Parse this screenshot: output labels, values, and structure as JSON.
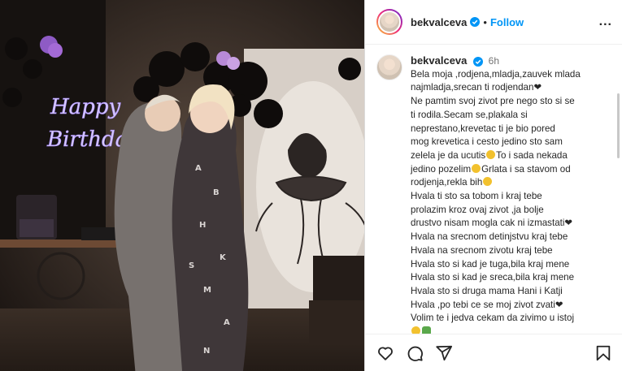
{
  "post": {
    "username": "bekvalceva",
    "follow_label": "Follow",
    "dot": "•",
    "more_label": "...",
    "photo": {
      "neon_line1": "Happy",
      "neon_line2": "Birthday",
      "neon_color": "#c9b8ff"
    }
  },
  "caption": {
    "username": "bekvalceva",
    "time": "6h",
    "lines": [
      "Bela moja ,rodjena,mladja,zauvek mlada",
      "najmladja,srecan ti rodjendan❤",
      "Ne pamtim svoj zivot pre nego sto si se",
      "ti rodila.Secam se,plakala si",
      "neprestano,krevetac ti je bio pored",
      "mog krevetica i cesto jedino sto sam",
      "zelela je da ucutis",
      "To i sada nekada",
      "jedino pozelim",
      "Grlata i sa stavom od",
      "rodjenja,rekla bih",
      "Hvala ti sto sa tobom i kraj tebe",
      "prolazim kroz ovaj zivot ,ja bolje",
      "drustvo nisam mogla cak ni izmastati❤",
      "Hvala na srecnom detinjstvu kraj tebe",
      "Hvala na srecnom zivotu kraj tebe",
      "Hvala sto si kad je tuga,bila kraj mene",
      "Hvala sto si kad je sreca,bila kraj mene",
      "Hvala sto si druga mama Hani i Katji",
      "Hvala ,po tebi ce se moj zivot zvati❤",
      "Volim te i jedva cekam da zivimo u istoj"
    ]
  },
  "colors": {
    "accent": "#0095f6",
    "text": "#262626",
    "muted": "#737373"
  },
  "icons": [
    "verified-badge-icon",
    "more-icon",
    "heart-icon",
    "comment-icon",
    "share-icon",
    "bookmark-icon"
  ]
}
